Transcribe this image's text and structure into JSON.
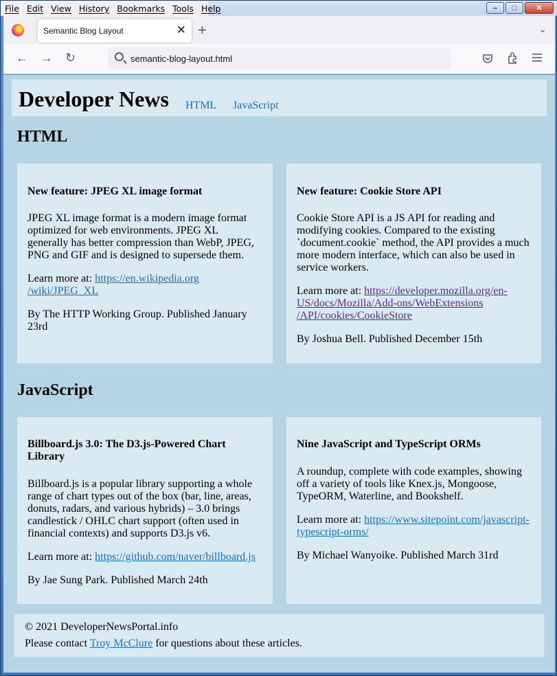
{
  "menu": [
    "File",
    "Edit",
    "View",
    "History",
    "Bookmarks",
    "Tools",
    "Help"
  ],
  "window_controls": {
    "minimize": "–",
    "maximize": "□",
    "close": "✕"
  },
  "browser": {
    "tab_title": "Semantic Blog Layout",
    "url": "semantic-blog-layout.html",
    "new_tab": "+",
    "tab_close": "✕"
  },
  "site": {
    "title": "Developer News",
    "nav": [
      "HTML",
      "JavaScript"
    ]
  },
  "sections": [
    {
      "title": "HTML",
      "articles": [
        {
          "title": "New feature: JPEG XL image format",
          "body": [
            "JPEG XL image format is a modern image format",
            "optimized for web environments. JPEG XL",
            "generally has better compression than WebP, JPEG,",
            "PNG and GIF and is designed to supersede them."
          ],
          "learn_prefix": "Learn more at:",
          "link": [
            "https://en.wikipedia.org",
            "/wiki/JPEG_XL"
          ],
          "byline": [
            "By The HTTP Working Group. Published January",
            "23rd"
          ]
        },
        {
          "title": "New feature: Cookie Store API",
          "body": [
            "Cookie Store API is a JS API for reading and",
            "modifying cookies. Compared to the existing",
            "`document.cookie` method, the API provides a much",
            "more modern interface, which can also be used in",
            "service workers."
          ],
          "learn_prefix": "Learn more at:",
          "link": [
            "https://developer.mozilla.org/en-",
            "US/docs/Mozilla/Add-ons/WebExtensions",
            "/API/cookies/CookieStore"
          ],
          "byline": [
            "By Joshua Bell. Published December 15th"
          ]
        }
      ]
    },
    {
      "title": "JavaScript",
      "articles": [
        {
          "title": [
            "Billboard.js 3.0: The D3.js-Powered Chart",
            "Library"
          ],
          "body": [
            "Billboard.js is a popular library supporting a whole",
            "range of chart types out of the box (bar, line, areas,",
            "donuts, radars, and various hybrids) – 3.0 brings",
            "candlestick / OHLC chart support (often used in",
            "financial contexts) and supports D3.js v6."
          ],
          "learn_prefix": "Learn more at:",
          "link": [
            "https://github.com/naver/billboard.js"
          ],
          "byline": [
            "By Jae Sung Park. Published March 24th"
          ]
        },
        {
          "title": "Nine JavaScript and TypeScript ORMs",
          "body": [
            "A roundup, complete with code examples, showing",
            "off a variety of tools like Knex.js, Mongoose,",
            "TypeORM, Waterline, and Bookshelf."
          ],
          "learn_prefix": "Learn more at:",
          "link": [
            "https://www.sitepoint.com/javascript-",
            "typescript-orms/"
          ],
          "byline": [
            "By Michael Wanyoike. Published March 31rd"
          ]
        }
      ]
    }
  ],
  "footer": {
    "copyright": "© 2021 DeveloperNewsPortal.info",
    "contact_prefix": "Please contact",
    "contact_name": "Troy McClure",
    "contact_suffix": "for questions about these articles."
  }
}
